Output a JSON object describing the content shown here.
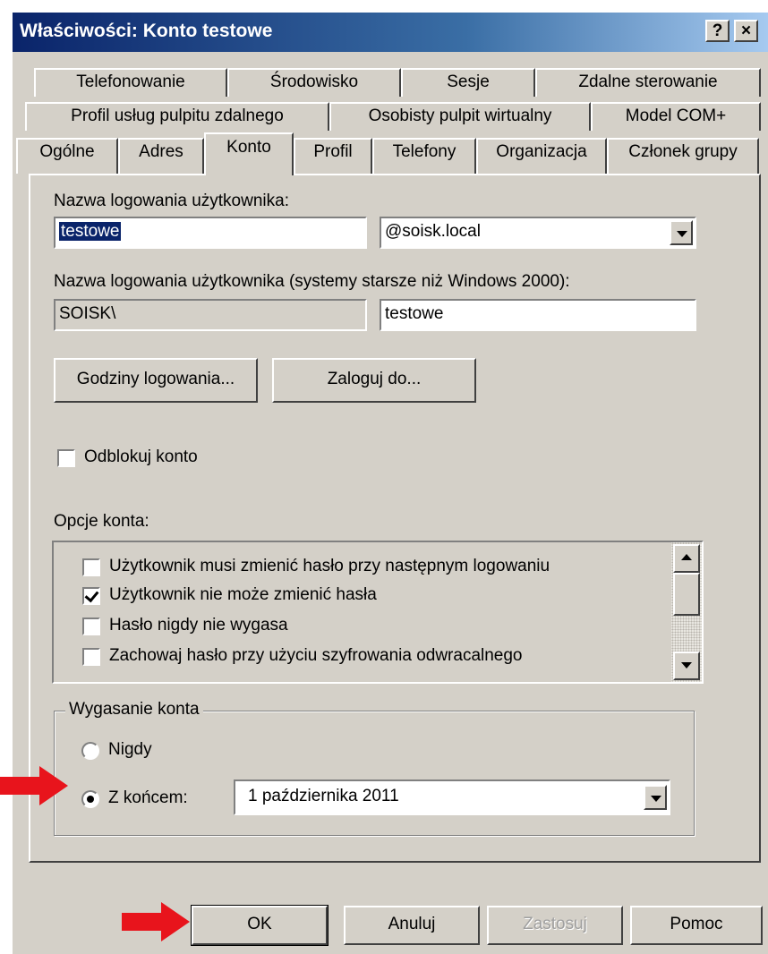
{
  "window": {
    "title": "Właściwości: Konto testowe",
    "help_button": "?",
    "close_button": "×"
  },
  "tabs": {
    "row1": [
      "Telefonowanie",
      "Środowisko",
      "Sesje",
      "Zdalne sterowanie"
    ],
    "row2": [
      "Profil usług pulpitu zdalnego",
      "Osobisty pulpit wirtualny",
      "Model COM+"
    ],
    "row3": [
      "Ogólne",
      "Adres",
      "Konto",
      "Profil",
      "Telefony",
      "Organizacja",
      "Członek grupy"
    ],
    "active": "Konto"
  },
  "account": {
    "logon_name_label": "Nazwa logowania użytkownika:",
    "logon_name_value": "testowe",
    "domain_value": "@soisk.local",
    "legacy_label": "Nazwa logowania użytkownika (systemy starsze niż Windows 2000):",
    "legacy_domain": "SOISK\\",
    "legacy_name": "testowe",
    "logon_hours_button": "Godziny logowania...",
    "logon_to_button": "Zaloguj do...",
    "unlock_label": "Odblokuj konto",
    "unlock_checked": false
  },
  "options": {
    "label": "Opcje konta:",
    "items": [
      {
        "label": "Użytkownik musi zmienić hasło przy następnym logowaniu",
        "checked": false
      },
      {
        "label": "Użytkownik nie może zmienić hasła",
        "checked": true
      },
      {
        "label": "Hasło nigdy nie wygasa",
        "checked": false
      },
      {
        "label": "Zachowaj hasło przy użyciu szyfrowania odwracalnego",
        "checked": false
      }
    ]
  },
  "expiration": {
    "label": "Wygasanie konta",
    "never_label": "Nigdy",
    "end_of_label": "Z końcem:",
    "end_of_date": "1 października 2011",
    "selected": "end_of"
  },
  "buttons": {
    "ok": "OK",
    "cancel": "Anuluj",
    "apply": "Zastosuj",
    "help": "Pomoc"
  },
  "colors": {
    "annotation_arrow": "#e8141c",
    "titlebar": "#0a246a",
    "dialog_bg": "#d4d0c8"
  }
}
